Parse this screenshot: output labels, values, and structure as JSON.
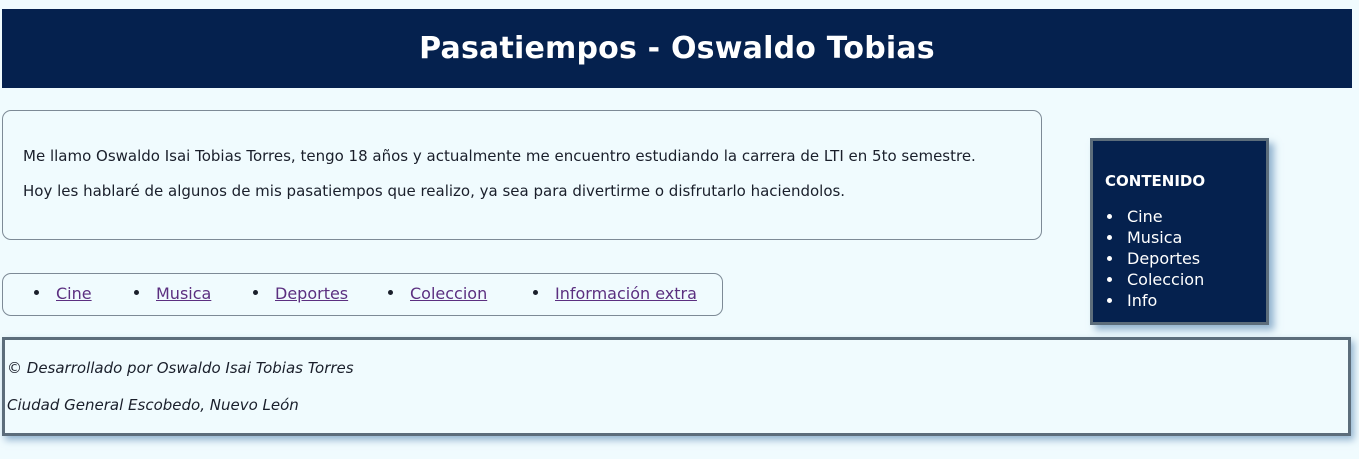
{
  "header": {
    "title": "Pasatiempos - Oswaldo Tobias"
  },
  "intro": {
    "paragraph1": "Me llamo Oswaldo Isai Tobias Torres, tengo 18 años y actualmente me encuentro estudiando la carrera de LTI en 5to semestre.",
    "paragraph2": "Hoy les hablaré de algunos de mis pasatiempos que realizo, ya sea para divertirme o disfrutarlo haciendolos."
  },
  "nav": {
    "links": [
      {
        "label": "Cine"
      },
      {
        "label": "Musica"
      },
      {
        "label": "Deportes"
      },
      {
        "label": "Coleccion"
      },
      {
        "label": "Información extra"
      }
    ]
  },
  "sidebar": {
    "heading": "CONTENIDO",
    "items": [
      {
        "label": "Cine"
      },
      {
        "label": "Musica"
      },
      {
        "label": "Deportes"
      },
      {
        "label": "Coleccion"
      },
      {
        "label": "Info"
      }
    ]
  },
  "footer": {
    "credit": "© Desarrollado por Oswaldo Isai Tobias Torres",
    "location": "Ciudad General Escobedo, Nuevo León"
  },
  "colors": {
    "header_bg": "#05214e",
    "page_bg": "#f0fbfe",
    "link": "#5b2f80",
    "box_border": "#5c6d7b"
  }
}
